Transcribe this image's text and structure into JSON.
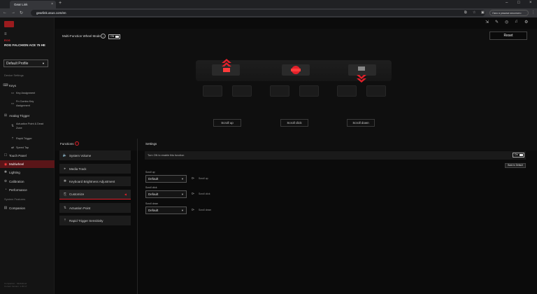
{
  "browser": {
    "tab_title": "Gear Link",
    "url": "gearlink.asus.com/en",
    "promo": "Окно в режиме инкогнито"
  },
  "sidebar": {
    "brand": "ROG",
    "device": "ROG FALCHION ACE 75 HE",
    "profile": "Default Profile",
    "device_settings_label": "Device Settings",
    "items": [
      {
        "label": "Keys",
        "icon": "keyboard-icon"
      },
      {
        "label": "Key Assignment",
        "icon": "key-icon"
      },
      {
        "label": "Fn Combo Key Assignment",
        "icon": "combo-icon"
      },
      {
        "label": "Analog Trigger",
        "icon": "trigger-icon"
      },
      {
        "label": "Actuation Point & Dead Zone",
        "icon": "actuation-icon"
      },
      {
        "label": "Rapid Trigger",
        "icon": "rapid-icon"
      },
      {
        "label": "Speed Tap",
        "icon": "tap-icon"
      },
      {
        "label": "Touch Panel",
        "icon": "touch-icon"
      },
      {
        "label": "Multiwheel",
        "icon": "wheel-icon"
      },
      {
        "label": "Lighting",
        "icon": "light-icon"
      },
      {
        "label": "Calibration",
        "icon": "calibration-icon"
      },
      {
        "label": "Performance",
        "icon": "performance-icon"
      }
    ],
    "system_features_label": "System Features",
    "companion": "Companion",
    "footer_line1": "Companion · Multiwheel",
    "footer_line2": "Current Version: 1.00.17"
  },
  "top": {
    "mode_label": "Multi-Function Wheel Mode",
    "mode_toggle": "ON",
    "reset": "Reset",
    "scroll_up": "Scroll up",
    "scroll_click": "Scroll click",
    "scroll_down": "Scroll down"
  },
  "functions": {
    "title": "Functions",
    "items": [
      {
        "label": "System Volume",
        "icon": "volume-icon"
      },
      {
        "label": "Media Track",
        "icon": "media-icon"
      },
      {
        "label": "Keyboard Brightness Adjustment",
        "icon": "brightness-icon"
      },
      {
        "label": "Customize",
        "icon": "customize-icon"
      },
      {
        "label": "Actuation Point",
        "icon": "actuation-icon"
      },
      {
        "label": "Rapid Trigger Sensitivity",
        "icon": "rapid-icon"
      }
    ]
  },
  "settings": {
    "title": "Settings",
    "turn_on_text": "Turn ON to enable this function",
    "toggle": "On",
    "back_default": "Back to Default",
    "rows": [
      {
        "label": "Scroll up",
        "value": "Default",
        "result": "Scroll up"
      },
      {
        "label": "Scroll click",
        "value": "Default",
        "result": "Scroll click"
      },
      {
        "label": "Scroll down",
        "value": "Default",
        "result": "Scroll down"
      }
    ]
  },
  "colors": {
    "accent": "#e0202a",
    "active_nav": "#5a1518",
    "background": "#0b0b0b"
  }
}
